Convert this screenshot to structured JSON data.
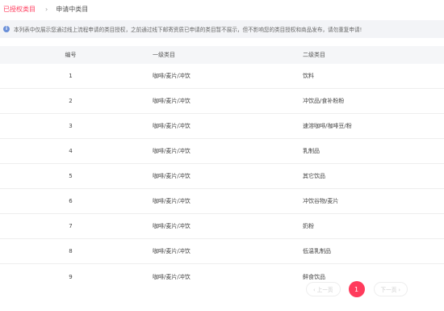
{
  "tabs": {
    "authorized": "已授权类目",
    "separator": "›",
    "applying": "申请中类目"
  },
  "notice": {
    "icon": "info-icon",
    "text": "本列表中仅展示您通过线上流程申请的类目授权，之前通过线下邮寄资质已申请的类目暂不展示，但不影响您的类目授权和商品发布，请勿重复申请!"
  },
  "table": {
    "headers": [
      "编号",
      "一级类目",
      "二级类目"
    ],
    "rows": [
      [
        "1",
        "咖啡/麦片/冲饮",
        "饮料"
      ],
      [
        "2",
        "咖啡/麦片/冲饮",
        "冲饮品/食补粉粉"
      ],
      [
        "3",
        "咖啡/麦片/冲饮",
        "速溶咖啡/咖啡豆/粉"
      ],
      [
        "4",
        "咖啡/麦片/冲饮",
        "乳制品"
      ],
      [
        "5",
        "咖啡/麦片/冲饮",
        "其它饮品"
      ],
      [
        "6",
        "咖啡/麦片/冲饮",
        "冲饮谷物/麦片"
      ],
      [
        "7",
        "咖啡/麦片/冲饮",
        "奶粉"
      ],
      [
        "8",
        "咖啡/麦片/冲饮",
        "低温乳制品"
      ],
      [
        "9",
        "咖啡/麦片/冲饮",
        "鲜食饮品"
      ]
    ]
  },
  "pagination": {
    "prev": "‹ 上一页",
    "current": "1",
    "next": "下一页 ›"
  },
  "colors": {
    "accent": "#ff3b5c",
    "info": "#6a8fd8"
  }
}
